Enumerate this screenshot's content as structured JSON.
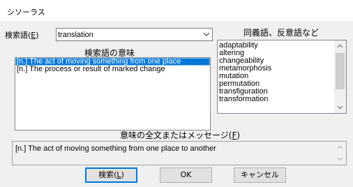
{
  "window": {
    "title": "シソーラス"
  },
  "search": {
    "label": "検索語(",
    "label_key": "E",
    "label_end": ")",
    "value": "translation"
  },
  "meanings": {
    "heading": "検索語の意味",
    "items": [
      "[n.] The act of moving something from one place",
      "[n.] The process or result of marked change"
    ],
    "selected_index": 0
  },
  "synonyms": {
    "heading": "同義語、反意語など",
    "items": [
      "adaptability",
      "altering",
      "changeability",
      "metamorphosis",
      "mutation",
      "permutation",
      "transfiguration",
      "transformation"
    ]
  },
  "full_text": {
    "label": "意味の全文またはメッセージ(",
    "label_key": "F",
    "label_end": ")",
    "value": "[n.] The act of moving something from one place to another"
  },
  "buttons": {
    "search_label": "検索(",
    "search_key": "L",
    "search_end": ")",
    "ok": "OK",
    "cancel": "キャンセル"
  },
  "colors": {
    "selection": "#0078d7",
    "dialog_bg": "#f0f0f0"
  }
}
